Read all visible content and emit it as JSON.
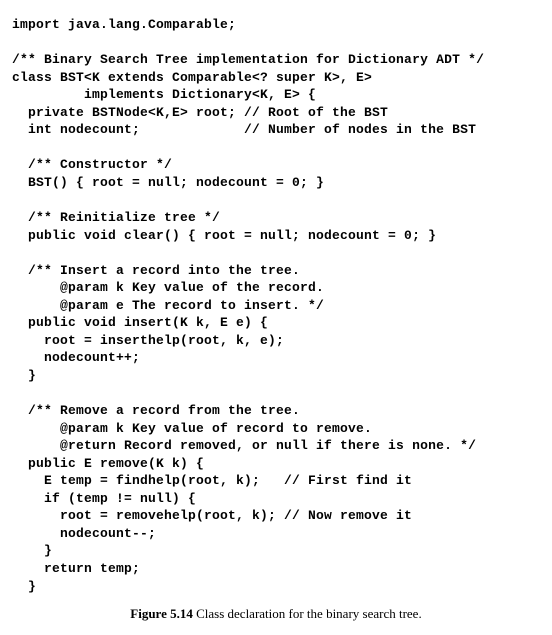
{
  "code": {
    "l01": "import java.lang.Comparable;",
    "l02": "",
    "l03": "/** Binary Search Tree implementation for Dictionary ADT */",
    "l04": "class BST<K extends Comparable<? super K>, E>",
    "l05": "         implements Dictionary<K, E> {",
    "l06": "  private BSTNode<K,E> root; // Root of the BST",
    "l07": "  int nodecount;             // Number of nodes in the BST",
    "l08": "",
    "l09": "  /** Constructor */",
    "l10": "  BST() { root = null; nodecount = 0; }",
    "l11": "",
    "l12": "  /** Reinitialize tree */",
    "l13": "  public void clear() { root = null; nodecount = 0; }",
    "l14": "",
    "l15": "  /** Insert a record into the tree.",
    "l16": "      @param k Key value of the record.",
    "l17": "      @param e The record to insert. */",
    "l18": "  public void insert(K k, E e) {",
    "l19": "    root = inserthelp(root, k, e);",
    "l20": "    nodecount++;",
    "l21": "  }",
    "l22": "",
    "l23": "  /** Remove a record from the tree.",
    "l24": "      @param k Key value of record to remove.",
    "l25": "      @return Record removed, or null if there is none. */",
    "l26": "  public E remove(K k) {",
    "l27": "    E temp = findhelp(root, k);   // First find it",
    "l28": "    if (temp != null) {",
    "l29": "      root = removehelp(root, k); // Now remove it",
    "l30": "      nodecount--;",
    "l31": "    }",
    "l32": "    return temp;",
    "l33": "  }"
  },
  "caption": {
    "label": "Figure 5.14",
    "text": " Class declaration for the binary search tree."
  }
}
